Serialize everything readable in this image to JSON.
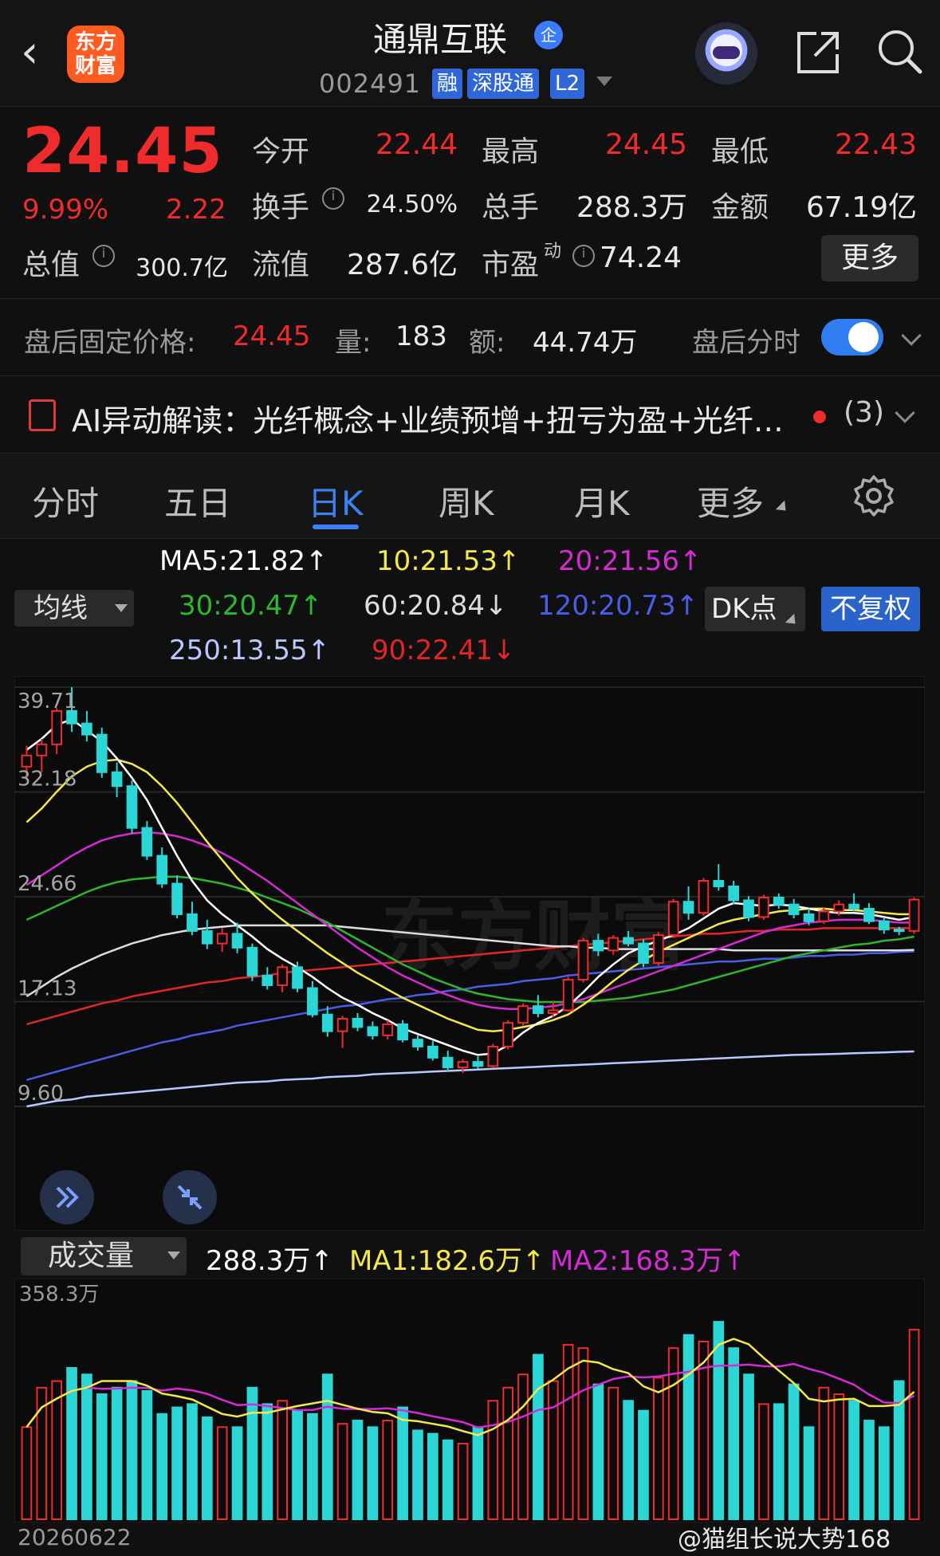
{
  "header": {
    "back_icon": "back-arrow-icon",
    "logo_text_1": "东方",
    "logo_text_2": "财富",
    "stock_name": "通鼎互联",
    "qi_badge": "企",
    "code": "002491",
    "tags": [
      "融",
      "深股通",
      "L2"
    ]
  },
  "quote": {
    "price": "24.45",
    "change_pct": "9.99%",
    "change": "2.22",
    "open_label": "今开",
    "open": "22.44",
    "high_label": "最高",
    "high": "24.45",
    "low_label": "最低",
    "low": "22.43",
    "turnover_label": "换手",
    "turnover": "24.50%",
    "volume_label": "总手",
    "volume": "288.3万",
    "amount_label": "金额",
    "amount": "67.19亿",
    "mcap_label": "总值",
    "mcap": "300.7亿",
    "float_label": "流值",
    "float": "287.6亿",
    "pe_label": "市盈",
    "pe_sup": "动",
    "pe": "74.24",
    "more_label": "更多",
    "info_icon": "i"
  },
  "after_hours": {
    "price_label": "盘后固定价格:",
    "price": "24.45",
    "vol_label": "量:",
    "vol": "183",
    "amt_label": "额:",
    "amt": "44.74万",
    "switch_label": "盘后分时"
  },
  "ai": {
    "text": "AI异动解读：光纤概念+业绩预增+扭亏为盈+光纤…",
    "count": "(3)"
  },
  "tabs": [
    "分时",
    "五日",
    "日K",
    "周K",
    "月K",
    "更多"
  ],
  "ma_panel": {
    "selector": "均线",
    "ma5": "MA5:21.82↑",
    "ma10": "10:21.53↑",
    "ma20": "20:21.56↑",
    "ma30": "30:20.47↑",
    "ma60": "60:20.84↓",
    "ma120": "120:20.73↑",
    "ma250": "250:13.55↑",
    "ma90": "90:22.41↓",
    "dk": "DK点",
    "fuquan": "不复权"
  },
  "colors": {
    "up": "#f02b2b",
    "down": "#2ad6d6",
    "ma5": "#ffffff",
    "ma10": "#f5e84a",
    "ma20": "#d62ad6",
    "ma30": "#2fb62f",
    "ma60": "#dddddd",
    "ma120": "#4a5de8",
    "ma250": "#b9c8ff",
    "ma90": "#e02626"
  },
  "k_axis": {
    "labels": [
      "39.71",
      "32.18",
      "24.66",
      "17.13",
      "9.60"
    ],
    "watermark": "东方财富"
  },
  "volume_panel": {
    "selector": "成交量",
    "vol": "288.3万↑",
    "ma1": "MA1:182.6万↑",
    "ma2": "MA2:168.3万↑",
    "axis_max": "358.3万",
    "date": "20260622"
  },
  "watermark_user": "@猫组长说大势168",
  "chart_data": {
    "type": "candlestick",
    "ylim": [
      9.6,
      39.71
    ],
    "y_ticks": [
      39.71,
      32.18,
      24.66,
      17.13,
      9.6
    ],
    "candles": [
      [
        34.0,
        35.5,
        33.0,
        34.8
      ],
      [
        34.8,
        36.0,
        33.6,
        35.6
      ],
      [
        35.6,
        38.2,
        34.9,
        38.0
      ],
      [
        38.0,
        39.71,
        36.5,
        37.1
      ],
      [
        37.1,
        38.0,
        35.8,
        36.3
      ],
      [
        36.3,
        36.8,
        33.2,
        33.6
      ],
      [
        33.6,
        34.3,
        31.8,
        32.6
      ],
      [
        32.6,
        33.0,
        29.2,
        29.6
      ],
      [
        29.6,
        30.1,
        27.3,
        27.6
      ],
      [
        27.6,
        28.2,
        25.3,
        25.6
      ],
      [
        25.6,
        26.2,
        23.1,
        23.4
      ],
      [
        23.4,
        24.3,
        21.9,
        22.2
      ],
      [
        22.2,
        23.0,
        20.9,
        21.3
      ],
      [
        21.3,
        22.4,
        20.7,
        22.0
      ],
      [
        22.0,
        22.8,
        20.6,
        21.0
      ],
      [
        21.0,
        21.3,
        18.6,
        19.0
      ],
      [
        19.0,
        19.6,
        18.0,
        18.3
      ],
      [
        18.3,
        19.8,
        17.8,
        19.6
      ],
      [
        19.6,
        20.0,
        17.8,
        18.1
      ],
      [
        18.1,
        18.6,
        16.0,
        16.2
      ],
      [
        16.2,
        16.8,
        14.6,
        15.0
      ],
      [
        15.0,
        16.1,
        13.8,
        15.9
      ],
      [
        15.9,
        16.3,
        15.0,
        15.3
      ],
      [
        15.3,
        15.7,
        14.4,
        14.7
      ],
      [
        14.7,
        15.8,
        14.4,
        15.5
      ],
      [
        15.5,
        15.8,
        14.2,
        14.4
      ],
      [
        14.4,
        14.7,
        13.6,
        13.9
      ],
      [
        13.9,
        14.3,
        12.9,
        13.1
      ],
      [
        13.1,
        13.6,
        12.1,
        12.4
      ],
      [
        12.4,
        13.0,
        12.0,
        12.8
      ],
      [
        12.8,
        13.2,
        12.3,
        12.5
      ],
      [
        12.5,
        14.1,
        12.4,
        13.9
      ],
      [
        13.9,
        15.8,
        13.7,
        15.6
      ],
      [
        15.6,
        17.0,
        15.4,
        16.8
      ],
      [
        16.8,
        17.6,
        16.0,
        16.3
      ],
      [
        16.3,
        17.2,
        16.0,
        16.5
      ],
      [
        16.5,
        18.9,
        16.4,
        18.7
      ],
      [
        18.7,
        21.7,
        18.5,
        21.5
      ],
      [
        21.5,
        22.0,
        20.4,
        20.8
      ],
      [
        20.8,
        21.9,
        20.5,
        21.7
      ],
      [
        21.7,
        22.2,
        21.1,
        21.3
      ],
      [
        21.3,
        21.6,
        19.6,
        19.9
      ],
      [
        19.9,
        22.1,
        19.7,
        21.9
      ],
      [
        21.9,
        24.5,
        21.7,
        24.3
      ],
      [
        24.3,
        25.4,
        23.0,
        23.5
      ],
      [
        23.5,
        26.0,
        23.3,
        25.8
      ],
      [
        25.8,
        27.0,
        25.1,
        25.4
      ],
      [
        25.4,
        25.8,
        24.1,
        24.4
      ],
      [
        24.4,
        24.7,
        22.9,
        23.2
      ],
      [
        23.2,
        24.8,
        23.0,
        24.6
      ],
      [
        24.6,
        24.9,
        23.8,
        24.1
      ],
      [
        24.1,
        24.5,
        23.1,
        23.4
      ],
      [
        23.4,
        23.8,
        22.6,
        22.9
      ],
      [
        22.9,
        23.9,
        22.7,
        23.6
      ],
      [
        23.6,
        24.4,
        23.3,
        24.1
      ],
      [
        24.1,
        24.9,
        23.6,
        23.8
      ],
      [
        23.8,
        24.2,
        22.7,
        22.9
      ],
      [
        22.9,
        23.2,
        22.0,
        22.3
      ],
      [
        22.3,
        22.5,
        21.9,
        22.2
      ],
      [
        22.2,
        24.6,
        22.0,
        24.45
      ]
    ],
    "ma5": [
      35.2,
      36.0,
      37.0,
      37.4,
      36.6,
      35.8,
      34.6,
      33.2,
      31.6,
      29.6,
      27.6,
      25.8,
      24.4,
      23.4,
      22.6,
      21.8,
      20.9,
      20.2,
      19.6,
      18.9,
      18.1,
      17.4,
      16.9,
      16.3,
      15.8,
      15.2,
      14.8,
      14.4,
      14.0,
      13.6,
      13.3,
      13.4,
      14.0,
      14.9,
      15.6,
      16.1,
      16.8,
      17.8,
      18.9,
      19.8,
      20.6,
      21.1,
      21.5,
      21.9,
      22.4,
      23.1,
      23.8,
      24.2,
      24.1,
      24.0,
      24.1,
      24.0,
      23.8,
      23.6,
      23.5,
      23.5,
      23.4,
      23.2,
      23.0,
      23.2
    ],
    "ma10": [
      30.0,
      31.0,
      32.2,
      33.3,
      34.0,
      34.4,
      34.5,
      34.2,
      33.6,
      32.6,
      31.4,
      30.0,
      28.6,
      27.3,
      26.0,
      24.9,
      23.9,
      23.0,
      22.2,
      21.4,
      20.6,
      19.9,
      19.2,
      18.6,
      18.0,
      17.4,
      16.9,
      16.4,
      15.9,
      15.5,
      15.1,
      15.0,
      15.1,
      15.3,
      15.5,
      15.8,
      16.2,
      16.9,
      17.7,
      18.6,
      19.4,
      20.1,
      20.7,
      21.2,
      21.7,
      22.2,
      22.7,
      23.0,
      23.2,
      23.4,
      23.6,
      23.7,
      23.8,
      23.8,
      23.7,
      23.7,
      23.6,
      23.5,
      23.4,
      23.4
    ],
    "ma20": [
      25.5,
      26.2,
      26.9,
      27.6,
      28.2,
      28.7,
      29.0,
      29.2,
      29.3,
      29.2,
      29.0,
      28.7,
      28.3,
      27.8,
      27.2,
      26.5,
      25.8,
      25.0,
      24.2,
      23.4,
      22.6,
      21.8,
      21.0,
      20.3,
      19.6,
      19.0,
      18.5,
      18.0,
      17.6,
      17.2,
      16.9,
      16.7,
      16.6,
      16.6,
      16.7,
      16.8,
      17.0,
      17.3,
      17.7,
      18.1,
      18.5,
      18.9,
      19.3,
      19.7,
      20.1,
      20.5,
      20.9,
      21.3,
      21.7,
      22.1,
      22.4,
      22.6,
      22.8,
      22.9,
      23.0,
      23.0,
      23.0,
      22.9,
      22.8,
      22.8
    ],
    "ma30": [
      23.0,
      23.5,
      24.0,
      24.5,
      25.0,
      25.4,
      25.7,
      25.9,
      26.0,
      26.1,
      26.1,
      26.0,
      25.8,
      25.6,
      25.3,
      25.0,
      24.6,
      24.2,
      23.8,
      23.3,
      22.8,
      22.2,
      21.6,
      21.0,
      20.4,
      19.8,
      19.3,
      18.8,
      18.4,
      18.0,
      17.7,
      17.5,
      17.3,
      17.2,
      17.1,
      17.1,
      17.1,
      17.1,
      17.2,
      17.3,
      17.4,
      17.6,
      17.8,
      18.0,
      18.3,
      18.6,
      18.9,
      19.2,
      19.5,
      19.8,
      20.1,
      20.4,
      20.6,
      20.8,
      21.0,
      21.2,
      21.3,
      21.5,
      21.6,
      21.8
    ],
    "ma60": [
      17.5,
      18.2,
      18.9,
      19.5,
      20.0,
      20.5,
      20.9,
      21.3,
      21.6,
      21.9,
      22.1,
      22.3,
      22.4,
      22.5,
      22.6,
      22.6,
      22.6,
      22.6,
      22.6,
      22.6,
      22.6,
      22.5,
      22.4,
      22.3,
      22.2,
      22.1,
      22.0,
      21.9,
      21.8,
      21.7,
      21.6,
      21.5,
      21.4,
      21.3,
      21.2,
      21.1,
      21.1,
      21.0,
      21.0,
      20.9,
      20.9,
      20.9,
      20.9,
      20.9,
      20.9,
      20.9,
      20.9,
      20.8,
      20.8,
      20.8,
      20.8,
      20.8,
      20.8,
      20.8,
      20.8,
      20.8,
      20.8,
      20.8,
      20.8,
      20.84
    ],
    "ma90": [
      15.5,
      15.8,
      16.1,
      16.4,
      16.7,
      17.0,
      17.2,
      17.5,
      17.7,
      17.9,
      18.1,
      18.3,
      18.5,
      18.6,
      18.8,
      18.9,
      19.0,
      19.2,
      19.3,
      19.4,
      19.5,
      19.6,
      19.7,
      19.8,
      19.9,
      20.0,
      20.1,
      20.2,
      20.3,
      20.4,
      20.5,
      20.6,
      20.7,
      20.8,
      20.9,
      21.0,
      21.1,
      21.2,
      21.3,
      21.4,
      21.5,
      21.6,
      21.7,
      21.8,
      21.9,
      22.0,
      22.0,
      22.1,
      22.2,
      22.2,
      22.3,
      22.3,
      22.3,
      22.4,
      22.4,
      22.4,
      22.4,
      22.4,
      22.4,
      22.41
    ],
    "ma120": [
      11.5,
      11.8,
      12.1,
      12.4,
      12.7,
      13.0,
      13.3,
      13.6,
      13.9,
      14.2,
      14.4,
      14.7,
      14.9,
      15.1,
      15.4,
      15.6,
      15.8,
      16.0,
      16.2,
      16.4,
      16.6,
      16.8,
      16.9,
      17.1,
      17.3,
      17.4,
      17.6,
      17.7,
      17.9,
      18.0,
      18.2,
      18.3,
      18.4,
      18.6,
      18.7,
      18.8,
      19.0,
      19.1,
      19.2,
      19.3,
      19.4,
      19.5,
      19.6,
      19.7,
      19.8,
      19.9,
      20.0,
      20.0,
      20.1,
      20.2,
      20.2,
      20.3,
      20.4,
      20.4,
      20.5,
      20.5,
      20.6,
      20.6,
      20.7,
      20.73
    ],
    "ma250": [
      9.6,
      9.8,
      10.0,
      10.1,
      10.3,
      10.4,
      10.5,
      10.6,
      10.7,
      10.8,
      10.9,
      11.0,
      11.1,
      11.2,
      11.3,
      11.35,
      11.4,
      11.5,
      11.55,
      11.6,
      11.7,
      11.75,
      11.8,
      11.9,
      11.95,
      12.0,
      12.05,
      12.1,
      12.15,
      12.2,
      12.25,
      12.3,
      12.35,
      12.4,
      12.45,
      12.5,
      12.55,
      12.6,
      12.65,
      12.7,
      12.75,
      12.8,
      12.85,
      12.9,
      12.95,
      13.0,
      13.05,
      13.1,
      13.15,
      13.2,
      13.25,
      13.3,
      13.32,
      13.35,
      13.38,
      13.42,
      13.45,
      13.48,
      13.52,
      13.55
    ],
    "volume": [
      140,
      200,
      210,
      230,
      220,
      190,
      200,
      210,
      195,
      160,
      170,
      175,
      155,
      140,
      140,
      200,
      175,
      180,
      165,
      160,
      220,
      145,
      150,
      140,
      150,
      170,
      135,
      130,
      120,
      115,
      140,
      180,
      200,
      220,
      250,
      210,
      265,
      260,
      205,
      200,
      180,
      165,
      215,
      260,
      280,
      270,
      300,
      260,
      220,
      175,
      175,
      205,
      140,
      200,
      190,
      180,
      150,
      140,
      210,
      288
    ]
  }
}
